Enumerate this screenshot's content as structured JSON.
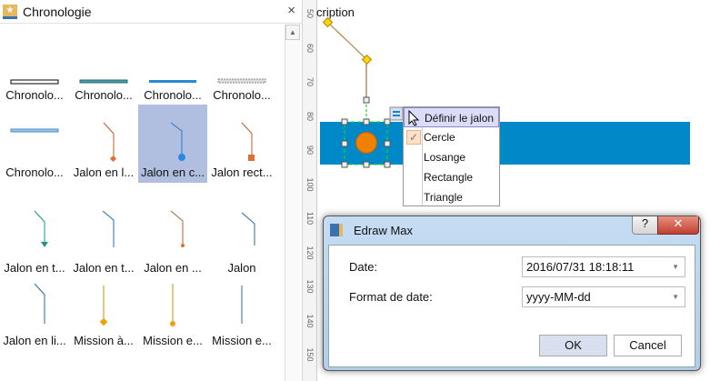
{
  "panel": {
    "title": "Chronologie",
    "close": "×",
    "scroll_up": "▲",
    "items": [
      {
        "label": "Chronolo...",
        "icon": "timeline-black-icon"
      },
      {
        "label": "Chronolo...",
        "icon": "timeline-teal-icon"
      },
      {
        "label": "Chronolo...",
        "icon": "timeline-blue-icon"
      },
      {
        "label": "Chronolo...",
        "icon": "timeline-gray-icon"
      },
      {
        "label": "Chronolo...",
        "icon": "timeline-dashed-icon"
      },
      {
        "label": "Jalon en l...",
        "icon": "milestone-diamond-icon"
      },
      {
        "label": "Jalon en c...",
        "icon": "milestone-circle-icon",
        "selected": true
      },
      {
        "label": "Jalon rect...",
        "icon": "milestone-rect-icon"
      },
      {
        "label": "Jalon en t...",
        "icon": "milestone-triangle-icon"
      },
      {
        "label": "Jalon en t...",
        "icon": "milestone-triangle2-icon"
      },
      {
        "label": "Jalon en ...",
        "icon": "milestone-dot-icon"
      },
      {
        "label": "Jalon",
        "icon": "milestone-line-icon"
      },
      {
        "label": "Jalon en li...",
        "icon": "milestone-line2-icon"
      },
      {
        "label": "Mission à...",
        "icon": "mission-diamond-icon"
      },
      {
        "label": "Mission e...",
        "icon": "mission-dot-icon"
      },
      {
        "label": "Mission e...",
        "icon": "mission-line-icon"
      }
    ]
  },
  "ruler": [
    "50",
    "60",
    "70",
    "80",
    "90",
    "100",
    "110",
    "120",
    "130",
    "140",
    "150"
  ],
  "canvas": {
    "description": "cription",
    "bar_color": "#0088c8",
    "milestone_color": "#f08000"
  },
  "menu": {
    "header": "Définir le jalon",
    "items": [
      "Cercle",
      "Losange",
      "Rectangle",
      "Triangle"
    ],
    "checked": "Cercle"
  },
  "dialog": {
    "title": "Edraw Max",
    "help": "?",
    "close": "✕",
    "date_label": "Date:",
    "date_value": "2016/07/31 18:18:11",
    "format_label": "Format de date:",
    "format_value": "yyyy-MM-dd",
    "ok": "OK",
    "cancel": "Cancel"
  }
}
